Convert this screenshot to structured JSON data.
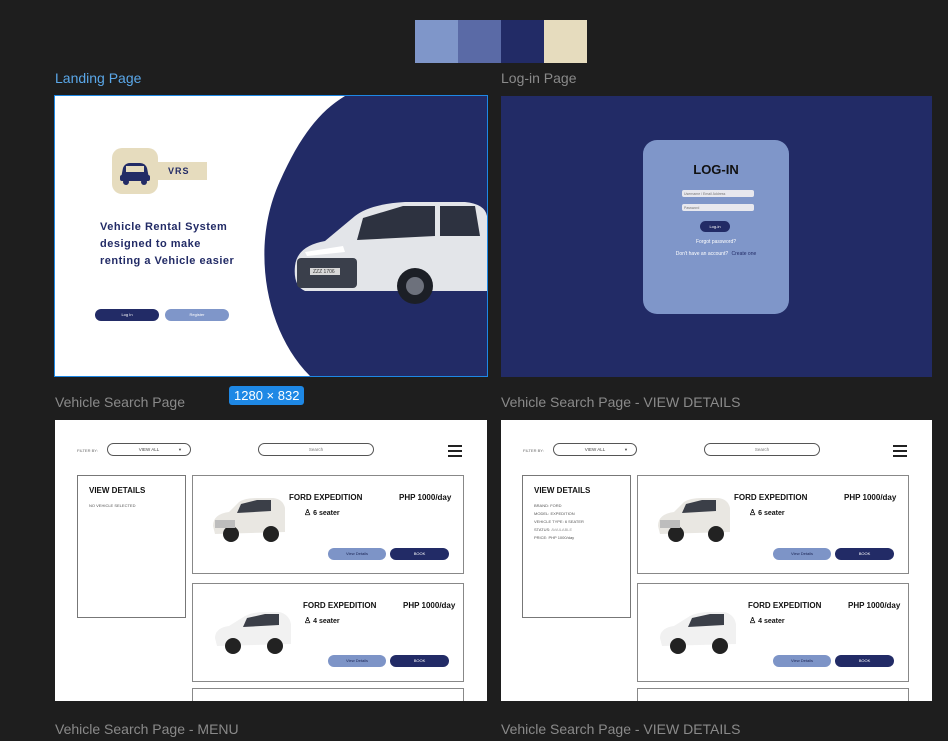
{
  "palette": {
    "colors": [
      "#7f96c9",
      "#5a6aa6",
      "#222b66",
      "#e6dcbe"
    ]
  },
  "frames": {
    "landing_label": "Landing Page",
    "login_label": "Log-in Page",
    "search_label": "Vehicle Search Page",
    "search_details_label": "Vehicle Search Page - VIEW DETAILS",
    "menu_label": "Vehicle Search Page - MENU",
    "details_label_bottom": "Vehicle Search Page - VIEW DETAILS",
    "size_badge": "1280 × 832"
  },
  "landing": {
    "logo_text": "VRS",
    "tagline_1": "Vehicle Rental System",
    "tagline_2": "designed to make",
    "tagline_3": "renting a Vehicle easier",
    "login_button": "Log In",
    "register_button": "Register",
    "plate": "ZZZ 1706"
  },
  "login": {
    "title": "LOG-IN",
    "username_placeholder": "Username / Email Address",
    "password_placeholder": "Password",
    "login_button": "Log-in",
    "forgot": "Forgot password?",
    "no_account": "Don't have an account?",
    "create": "Create one"
  },
  "search_page": {
    "filter_label": "FILTER BY:",
    "filter_value": "VIEW ALL",
    "search_placeholder": "Search",
    "details_title": "VIEW DETAILS",
    "no_vehicle": "NO VEHICLE SELECTED",
    "vehicles": [
      {
        "name": "FORD EXPEDITION",
        "price": "PHP 1000/day",
        "seats": "6 seater",
        "view": "View Details",
        "book": "BOOK"
      },
      {
        "name": "FORD EXPEDITION",
        "price": "PHP 1000/day",
        "seats": "4 seater",
        "view": "View Details",
        "book": "BOOK"
      }
    ]
  },
  "details_page": {
    "filter_label": "FILTER BY:",
    "filter_value": "VIEW ALL",
    "search_placeholder": "Search",
    "details_title": "VIEW DETAILS",
    "brand": "BRAND: FORD",
    "model": "MODEL: EXPEDITION",
    "type": "VEHICLE TYPE: 6 SEATER",
    "status_label": "STATUS:",
    "status_value": "AVAILABLE",
    "price": "PRICE: PHP 1000/day",
    "vehicles": [
      {
        "name": "FORD EXPEDITION",
        "price": "PHP 1000/day",
        "seats": "6 seater",
        "view": "View Details",
        "book": "BOOK"
      },
      {
        "name": "FORD EXPEDITION",
        "price": "PHP 1000/day",
        "seats": "4 seater",
        "view": "View Details",
        "book": "BOOK"
      }
    ]
  }
}
